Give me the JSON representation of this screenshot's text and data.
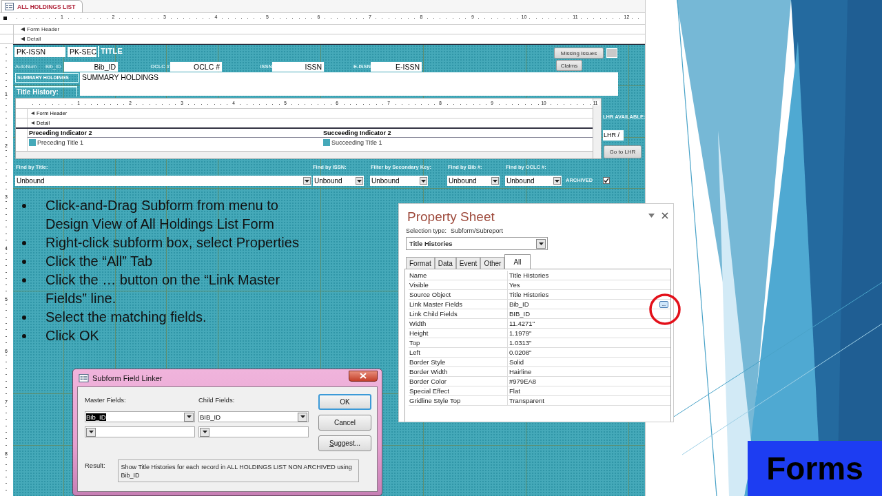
{
  "document_tab": {
    "title": "ALL HOLDINGS LIST"
  },
  "ruler": {
    "marks": [
      "1",
      "2",
      "3",
      "4",
      "5",
      "6",
      "7",
      "8",
      "9",
      "10",
      "11",
      "12"
    ]
  },
  "vertical_ruler": {
    "marks": [
      "1",
      "2",
      "3",
      "4",
      "5",
      "6",
      "7",
      "8"
    ]
  },
  "sections": [
    {
      "label": "Form Header"
    },
    {
      "label": "Detail"
    }
  ],
  "form": {
    "textboxes": [
      {
        "text": "PK-ISSN"
      },
      {
        "text": "PK-SEC"
      },
      {
        "text": "Bib_ID"
      },
      {
        "text": "OCLC #"
      },
      {
        "text": "ISSN"
      },
      {
        "text": "E-ISSN"
      },
      {
        "text": "SUMMARY HOLDINGS"
      },
      {
        "text": "LHR /"
      }
    ],
    "labels": [
      {
        "text": "TITLE"
      },
      {
        "text": "AutoNum"
      },
      {
        "text": "Bib_ID"
      },
      {
        "text": "OCLC #"
      },
      {
        "text": "ISSN"
      },
      {
        "text": "E-ISSN"
      },
      {
        "text": "SUMMARY HOLDINGS"
      },
      {
        "text": "Title History:"
      },
      {
        "text": "LHR AVAILABLE:"
      },
      {
        "text": "Find by Title:"
      },
      {
        "text": "Find by ISSN:"
      },
      {
        "text": "Filter by Secondary Key:"
      },
      {
        "text": "Find by Bib #:"
      },
      {
        "text": "Find by OCLC #:"
      },
      {
        "text": "ARCHIVED"
      }
    ],
    "buttons": [
      {
        "label": "Missing Issues"
      },
      {
        "label": "Claims"
      },
      {
        "label": "Go to LHR"
      }
    ],
    "combos": [
      {
        "value": "Unbound"
      },
      {
        "value": "Unbound"
      },
      {
        "value": "Unbound"
      },
      {
        "value": "Unbound"
      },
      {
        "value": "Unbound"
      }
    ],
    "archived_checkbox": {
      "checked": true
    },
    "subform": {
      "ruler_marks": [
        "1",
        "2",
        "3",
        "4",
        "5",
        "6",
        "7",
        "8",
        "9",
        "10",
        "11"
      ],
      "sections": [
        {
          "label": "Form Header"
        },
        {
          "label": "Detail"
        }
      ],
      "columns": [
        {
          "header": "Preceding Indicator 2",
          "field": "Preceding Title 1"
        },
        {
          "header": "Succeeding Indicator 2",
          "field": "Succeeding Title 1"
        }
      ]
    }
  },
  "bullets": [
    {
      "text": "Click-and-Drag Subform from menu to Design View of All Holdings List Form"
    },
    {
      "text": "Right-click subform box, select Properties"
    },
    {
      "text": "Click the “All” Tab"
    },
    {
      "text": "Click the … button on the “Link Master Fields” line."
    },
    {
      "text": "Select the matching fields."
    },
    {
      "text": "Click OK"
    }
  ],
  "property_sheet": {
    "title": "Property Sheet",
    "selection_type_label": "Selection type:",
    "selection_type": "Subform/Subreport",
    "object": "Title Histories",
    "tabs": [
      {
        "label": "Format",
        "selected": false
      },
      {
        "label": "Data",
        "selected": false
      },
      {
        "label": "Event",
        "selected": false
      },
      {
        "label": "Other",
        "selected": false
      },
      {
        "label": "All",
        "selected": true
      }
    ],
    "properties": [
      {
        "name": "Name",
        "value": "Title Histories"
      },
      {
        "name": "Visible",
        "value": "Yes"
      },
      {
        "name": "Source Object",
        "value": "Title Histories"
      },
      {
        "name": "Link Master Fields",
        "value": "Bib_ID",
        "builder_button": "...",
        "highlighted": true
      },
      {
        "name": "Link Child Fields",
        "value": "BIB_ID"
      },
      {
        "name": "Width",
        "value": "11.4271\""
      },
      {
        "name": "Height",
        "value": "1.1979\""
      },
      {
        "name": "Top",
        "value": "1.0313\""
      },
      {
        "name": "Left",
        "value": "0.0208\""
      },
      {
        "name": "Border Style",
        "value": "Solid"
      },
      {
        "name": "Border Width",
        "value": "Hairline"
      },
      {
        "name": "Border Color",
        "value": "#979EA8"
      },
      {
        "name": "Special Effect",
        "value": "Flat"
      },
      {
        "name": "Gridline Style Top",
        "value": "Transparent"
      }
    ]
  },
  "field_linker": {
    "title": "Subform Field Linker",
    "master_label": "Master Fields:",
    "child_label": "Child Fields:",
    "rows": [
      {
        "master": {
          "value": "Bib_ID",
          "highlighted": true
        },
        "child": {
          "value": "BIB_ID",
          "highlighted": false
        }
      }
    ],
    "buttons": [
      {
        "label": "OK",
        "default": true
      },
      {
        "label": "Cancel",
        "default": false
      },
      {
        "label": "Suggest...",
        "default": false
      }
    ],
    "result_label": "Result:",
    "result": "Show Title Histories for each record in ALL HOLDINGS LIST NON ARCHIVED using Bib_ID"
  },
  "slide_title": "Forms"
}
